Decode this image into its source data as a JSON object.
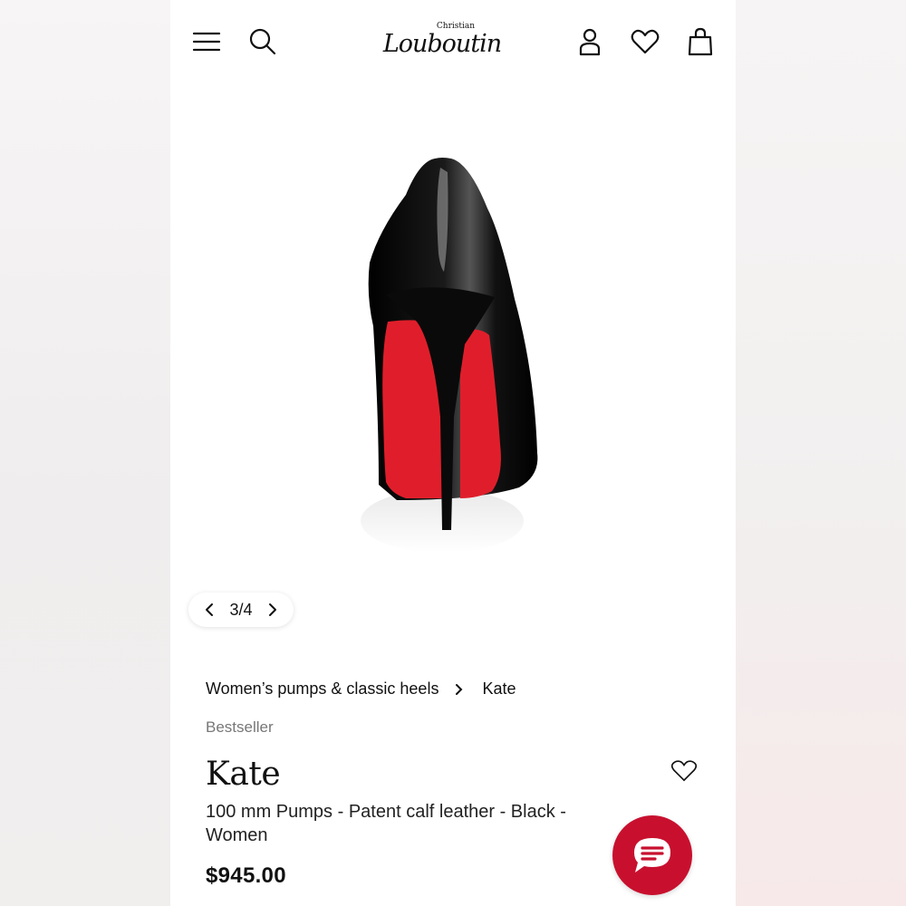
{
  "header": {
    "logo_top": "Christian",
    "logo_main": "Louboutin",
    "icons": [
      "menu-icon",
      "search-icon",
      "account-icon",
      "wishlist-icon",
      "bag-icon"
    ]
  },
  "gallery": {
    "position": "3/4"
  },
  "breadcrumb": {
    "category": "Women’s pumps & classic heels",
    "current": "Kate"
  },
  "product": {
    "badge": "Bestseller",
    "name": "Kate",
    "description": "100 mm Pumps - Patent calf leather - Black - Women",
    "price": "$945.00"
  },
  "colors": {
    "accent": "#c8102e",
    "sole_red": "#e01e2b",
    "text": "#111111",
    "muted": "#777777"
  }
}
